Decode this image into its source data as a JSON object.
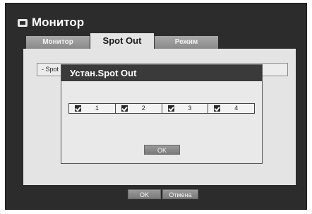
{
  "window": {
    "title": "Монитор",
    "icon": "monitor-icon"
  },
  "tabs": [
    {
      "label": "Монитор",
      "active": false
    },
    {
      "label": "Spot Out",
      "active": true
    },
    {
      "label": "Режим",
      "active": false
    }
  ],
  "spot_row": {
    "label": "- Spot"
  },
  "dialog": {
    "title": "Устан.Spot Out",
    "checkboxes": [
      {
        "label": "1",
        "checked": true
      },
      {
        "label": "2",
        "checked": true
      },
      {
        "label": "3",
        "checked": true
      },
      {
        "label": "4",
        "checked": true
      }
    ],
    "ok_label": "OK"
  },
  "footer": {
    "ok_label": "OK",
    "cancel_label": "Отмена"
  },
  "colors": {
    "window_bg": "#2c2c2c",
    "content_bg": "#e4e4e4",
    "tab_inactive": "#9a9a9a",
    "button": "#8a8a8a"
  }
}
